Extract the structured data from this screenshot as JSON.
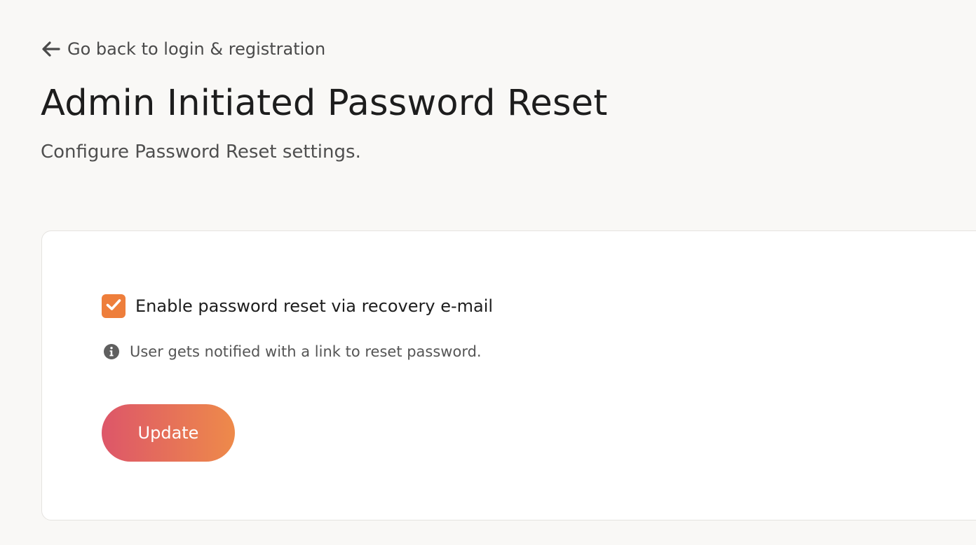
{
  "nav": {
    "back_label": "Go back to login & registration",
    "back_icon": "arrow-left-icon"
  },
  "header": {
    "title": "Admin Initiated Password Reset",
    "subtitle": "Configure Password Reset settings."
  },
  "form": {
    "checkbox": {
      "label": "Enable password reset via recovery e-mail",
      "checked": true,
      "icon": "checkmark-icon"
    },
    "hint": {
      "icon": "info-icon",
      "text": "User gets notified with a link to reset password."
    },
    "update_label": "Update"
  },
  "colors": {
    "accent": "#ee7e3b",
    "button_gradient_start": "#dd5669",
    "button_gradient_end": "#ee8a4a",
    "background": "#f9f8f6"
  }
}
